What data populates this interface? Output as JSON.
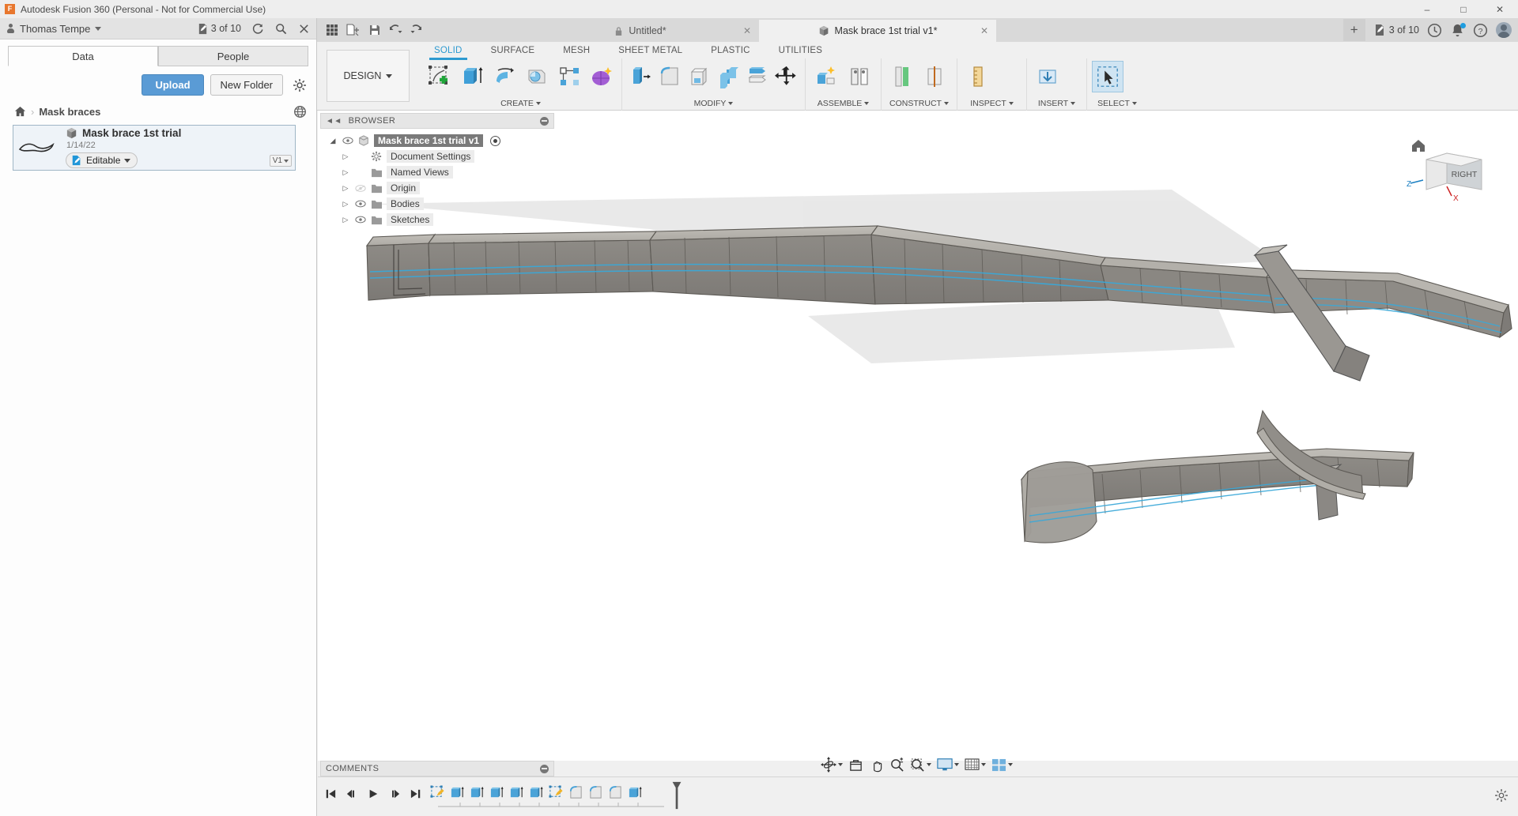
{
  "window": {
    "title": "Autodesk Fusion 360 (Personal - Not for Commercial Use)",
    "logo_letter": "F",
    "minimize": "–",
    "maximize": "□",
    "close": "✕"
  },
  "data_panel": {
    "user_name": "Thomas Tempe",
    "editable_count": "3 of 10",
    "refresh_icon": "refresh-icon",
    "search_icon": "search-icon",
    "close_icon": "close-icon",
    "tabs": [
      {
        "label": "Data",
        "active": true
      },
      {
        "label": "People",
        "active": false
      }
    ],
    "upload_label": "Upload",
    "new_folder_label": "New Folder",
    "settings_icon": "gear-icon",
    "breadcrumb": {
      "home_icon": "home-icon",
      "separator": "›",
      "folder": "Mask braces",
      "globe_icon": "globe-icon"
    },
    "file": {
      "name": "Mask brace 1st trial",
      "date": "1/14/22",
      "badge": "Editable",
      "version": "V1"
    }
  },
  "quick_access": [
    {
      "name": "grid-apps-icon"
    },
    {
      "name": "new-file-icon"
    },
    {
      "name": "save-icon"
    },
    {
      "name": "undo-icon"
    },
    {
      "name": "redo-icon"
    }
  ],
  "doc_tabs": [
    {
      "label": "Untitled*",
      "icon": "lock-icon",
      "active": false,
      "close": "✕"
    },
    {
      "label": "Mask brace 1st trial v1*",
      "icon": "cube-icon",
      "active": true,
      "close": "✕"
    }
  ],
  "top_right": {
    "new_tab": "+",
    "editable_count": "3 of 10",
    "recent_icon": "clock-icon",
    "notifications_icon": "bell-icon",
    "help_icon": "help-icon",
    "account_icon": "avatar-icon"
  },
  "ribbon": {
    "design_label": "DESIGN",
    "tabs": [
      {
        "label": "SOLID",
        "active": true
      },
      {
        "label": "SURFACE",
        "active": false
      },
      {
        "label": "MESH",
        "active": false
      },
      {
        "label": "SHEET METAL",
        "active": false
      },
      {
        "label": "PLASTIC",
        "active": false
      },
      {
        "label": "UTILITIES",
        "active": false
      }
    ],
    "panels": [
      {
        "label": "CREATE",
        "dropdown": true
      },
      {
        "label": "MODIFY",
        "dropdown": true
      },
      {
        "label": "ASSEMBLE",
        "dropdown": true
      },
      {
        "label": "CONSTRUCT",
        "dropdown": true
      },
      {
        "label": "INSPECT",
        "dropdown": true
      },
      {
        "label": "INSERT",
        "dropdown": true
      },
      {
        "label": "SELECT",
        "dropdown": true
      }
    ]
  },
  "browser": {
    "title": "BROWSER",
    "collapse_icon": "collapse-left-icon",
    "pin_icon": "minimize-circle-icon",
    "tree": [
      {
        "label": "Mask brace 1st trial v1",
        "icon": "component-icon",
        "eye": "visible",
        "arrow": "expand-down",
        "root": true,
        "target": true
      },
      {
        "label": "Document Settings",
        "icon": "gear-icon",
        "eye": "none",
        "arrow": "expand-right",
        "root": false,
        "target": false
      },
      {
        "label": "Named Views",
        "icon": "folder-icon",
        "eye": "none",
        "arrow": "expand-right",
        "root": false,
        "target": false
      },
      {
        "label": "Origin",
        "icon": "folder-icon",
        "eye": "hidden",
        "arrow": "expand-right",
        "root": false,
        "target": false
      },
      {
        "label": "Bodies",
        "icon": "folder-icon",
        "eye": "visible",
        "arrow": "expand-right",
        "root": false,
        "target": false
      },
      {
        "label": "Sketches",
        "icon": "folder-icon",
        "eye": "visible",
        "arrow": "expand-right",
        "root": false,
        "target": false
      }
    ]
  },
  "view_cube": {
    "face_label": "RIGHT",
    "axis_z": "Z",
    "axis_x": "X",
    "home_icon": "home-icon"
  },
  "comments": {
    "title": "COMMENTS",
    "pin_icon": "minimize-circle-icon"
  },
  "nav_bar": [
    {
      "name": "orbit-icon",
      "dropdown": true
    },
    {
      "name": "look-at-icon",
      "dropdown": false
    },
    {
      "name": "pan-icon",
      "dropdown": false
    },
    {
      "name": "zoom-icon",
      "dropdown": false
    },
    {
      "name": "zoom-window-icon",
      "dropdown": true
    },
    {
      "name": "display-settings-icon",
      "dropdown": true
    },
    {
      "name": "grid-snaps-icon",
      "dropdown": true
    },
    {
      "name": "viewports-icon",
      "dropdown": true
    }
  ],
  "timeline": {
    "playback": [
      {
        "name": "go-to-beginning-icon"
      },
      {
        "name": "step-back-icon"
      },
      {
        "name": "play-icon"
      },
      {
        "name": "step-forward-icon"
      },
      {
        "name": "go-to-end-icon"
      }
    ],
    "features": [
      {
        "name": "sketch-feature-icon",
        "type": "sketch"
      },
      {
        "name": "extrude-feature-icon",
        "type": "extrude"
      },
      {
        "name": "extrude-feature-icon",
        "type": "extrude"
      },
      {
        "name": "extrude-feature-icon",
        "type": "extrude"
      },
      {
        "name": "extrude-feature-icon",
        "type": "extrude"
      },
      {
        "name": "extrude-feature-icon",
        "type": "extrude"
      },
      {
        "name": "sketch-feature-icon",
        "type": "sketch"
      },
      {
        "name": "fillet-feature-icon",
        "type": "fillet"
      },
      {
        "name": "fillet-feature-icon",
        "type": "fillet"
      },
      {
        "name": "fillet-feature-icon",
        "type": "fillet"
      },
      {
        "name": "extrude-feature-icon",
        "type": "extrude"
      }
    ],
    "marker_icon": "timeline-marker-icon",
    "settings_icon": "timeline-settings-icon"
  }
}
